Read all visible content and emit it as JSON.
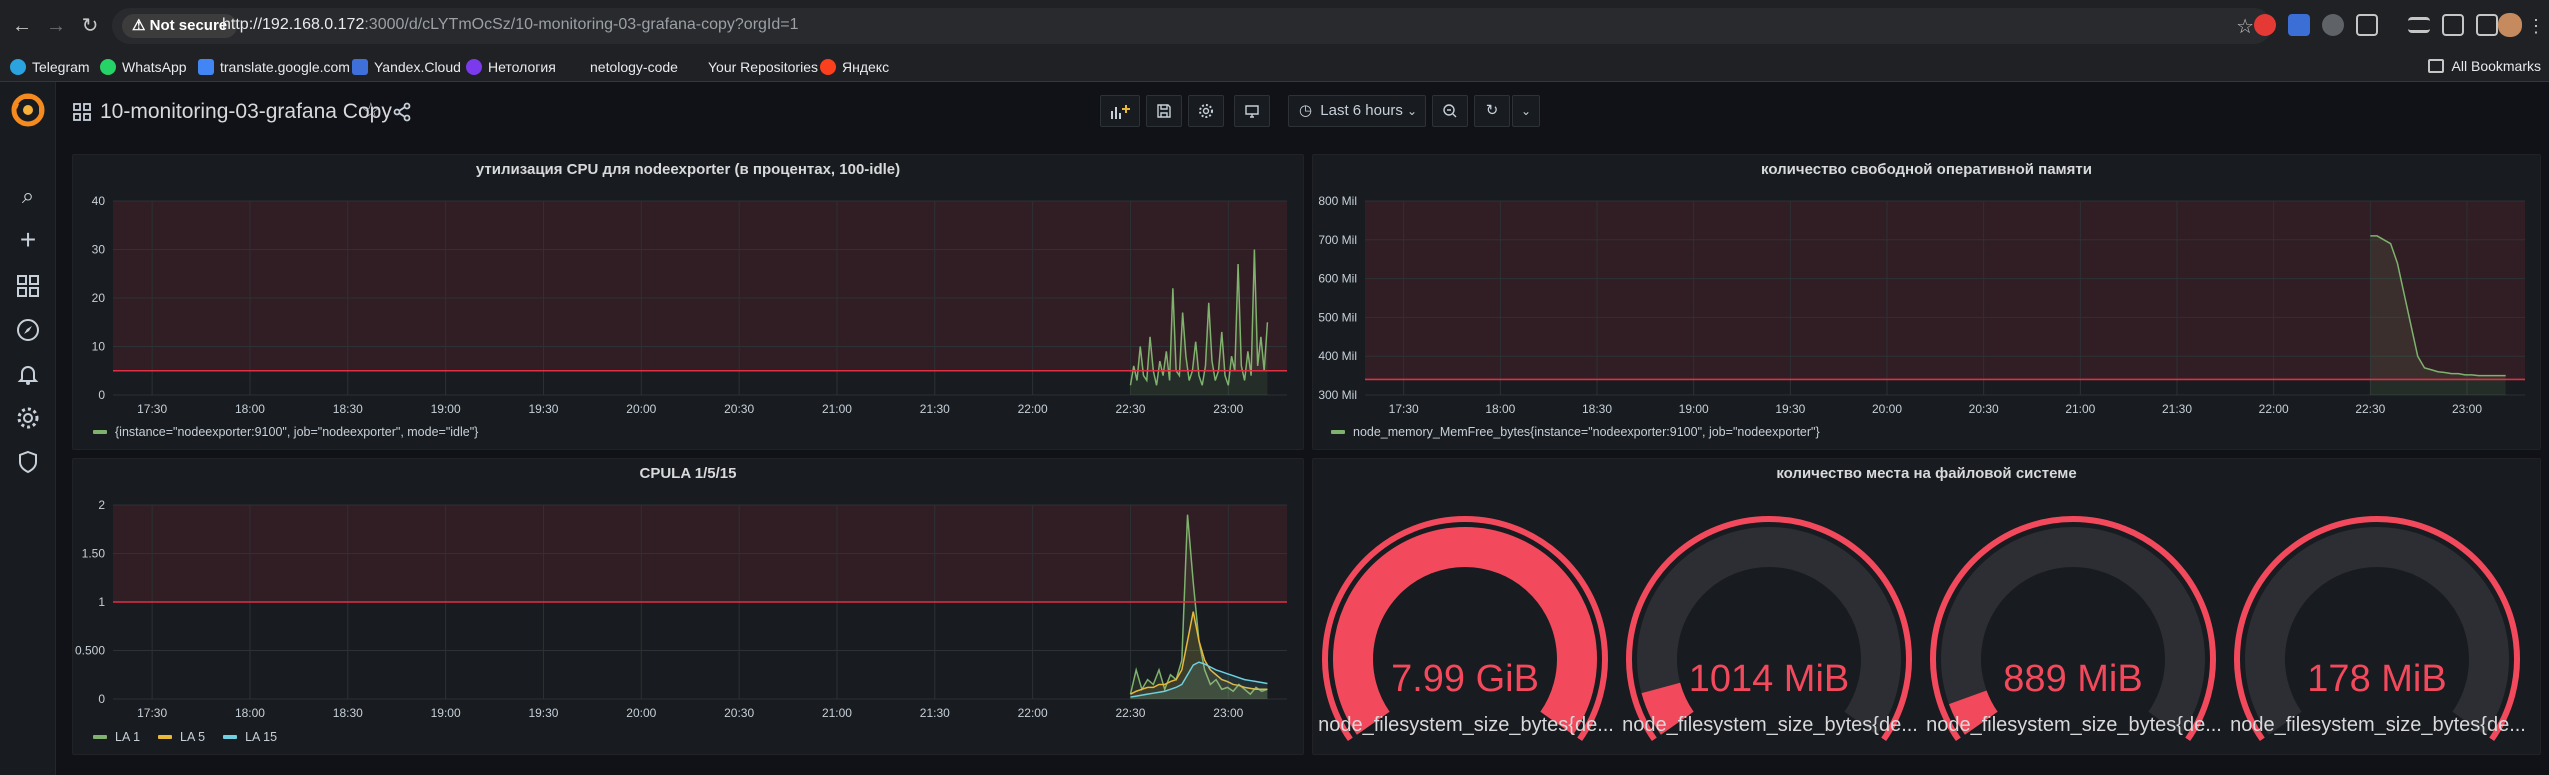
{
  "browser": {
    "security_label": "Not secure",
    "url_host": "http://192.168.0.172",
    "url_path": ":3000/d/cLYTmOcSz/10-monitoring-03-grafana-copy?orgId=1",
    "bookmarks": [
      {
        "label": "Telegram",
        "color": "#2aa3df"
      },
      {
        "label": "WhatsApp",
        "color": "#25d366"
      },
      {
        "label": "translate.google.com",
        "color": "#4285f4"
      },
      {
        "label": "Yandex.Cloud",
        "color": "#3f6fd8"
      },
      {
        "label": "Нетология",
        "color": "#7c3aed"
      },
      {
        "label": "netology-code",
        "color": "#202124"
      },
      {
        "label": "Your Repositories",
        "color": "#202124"
      },
      {
        "label": "Яндекс",
        "color": "#fc3f1d"
      }
    ],
    "all_bookmarks": "All Bookmarks"
  },
  "dashboard": {
    "title": "10-monitoring-03-grafana Copy",
    "time_range": "Last 6 hours"
  },
  "colors": {
    "series_green": "#7eb26d",
    "series_yellow": "#eab839",
    "series_cyan": "#6ed0e0",
    "threshold_red": "#e02f44",
    "gauge_red": "#f2495c",
    "gauge_track": "#2c2e33"
  },
  "panels": {
    "cpu": {
      "title": "утилизация CPU для nodeexporter (в процентах, 100-idle)",
      "legend": [
        "{instance=\"nodeexporter:9100\", job=\"nodeexporter\", mode=\"idle\"}"
      ]
    },
    "mem": {
      "title": "количество свободной оперативной памяти",
      "legend": [
        "node_memory_MemFree_bytes{instance=\"nodeexporter:9100\", job=\"nodeexporter\"}"
      ]
    },
    "la": {
      "title": "CPULA 1/5/15",
      "legend": [
        "LA 1",
        "LA 5",
        "LA 15"
      ]
    },
    "fs": {
      "title": "количество места на файловой системе",
      "gauges": [
        {
          "value": "7.99 GiB",
          "fill": 1.0,
          "label": "node_filesystem_size_bytes{de..."
        },
        {
          "value": "1014 MiB",
          "fill": 0.08,
          "label": "node_filesystem_size_bytes{de..."
        },
        {
          "value": "889 MiB",
          "fill": 0.06,
          "label": "node_filesystem_size_bytes{de..."
        },
        {
          "value": "178 MiB",
          "fill": 0.0,
          "label": "node_filesystem_size_bytes{de..."
        }
      ]
    }
  },
  "chart_data": [
    {
      "type": "line",
      "title": "утилизация CPU для nodeexporter (в процентах, 100-idle)",
      "x_ticks": [
        "17:30",
        "18:00",
        "18:30",
        "19:00",
        "19:30",
        "20:00",
        "20:30",
        "21:00",
        "21:30",
        "22:00",
        "22:30",
        "23:00"
      ],
      "y_ticks": [
        "0",
        "10",
        "20",
        "30",
        "40"
      ],
      "ylim": [
        0,
        40
      ],
      "threshold": 5,
      "series": [
        {
          "name": "{instance=\"nodeexporter:9100\", job=\"nodeexporter\", mode=\"idle\"}",
          "x_start": "22:30",
          "x_end": "23:12",
          "values": [
            2,
            6,
            3,
            10,
            4,
            3,
            12,
            5,
            2,
            7,
            4,
            9,
            3,
            22,
            5,
            4,
            17,
            8,
            3,
            5,
            11,
            4,
            2,
            6,
            19,
            7,
            3,
            5,
            13,
            4,
            2,
            8,
            5,
            27,
            6,
            3,
            9,
            4,
            30,
            6,
            12,
            5,
            15
          ]
        }
      ]
    },
    {
      "type": "line",
      "title": "количество свободной оперативной памяти",
      "x_ticks": [
        "17:30",
        "18:00",
        "18:30",
        "19:00",
        "19:30",
        "20:00",
        "20:30",
        "21:00",
        "21:30",
        "22:00",
        "22:30",
        "23:00"
      ],
      "y_ticks": [
        "300 Mil",
        "400 Mil",
        "500 Mil",
        "600 Mil",
        "700 Mil",
        "800 Mil"
      ],
      "ylim": [
        300,
        800
      ],
      "threshold": 340,
      "series": [
        {
          "name": "node_memory_MemFree_bytes{instance=\"nodeexporter:9100\", job=\"nodeexporter\"}",
          "x_start": "22:30",
          "x_end": "23:12",
          "values": [
            710,
            710,
            700,
            690,
            640,
            560,
            480,
            400,
            370,
            365,
            360,
            358,
            355,
            355,
            352,
            352,
            350,
            350,
            350,
            350,
            350
          ]
        }
      ]
    },
    {
      "type": "line",
      "title": "CPULA 1/5/15",
      "x_ticks": [
        "17:30",
        "18:00",
        "18:30",
        "19:00",
        "19:30",
        "20:00",
        "20:30",
        "21:00",
        "21:30",
        "22:00",
        "22:30",
        "23:00"
      ],
      "y_ticks": [
        "0",
        "0.500",
        "1",
        "1.50",
        "2"
      ],
      "ylim": [
        0,
        2
      ],
      "threshold": 1,
      "series": [
        {
          "name": "LA 1",
          "x_start": "22:30",
          "x_end": "23:12",
          "values": [
            0.05,
            0.3,
            0.1,
            0.2,
            0.15,
            0.3,
            0.1,
            0.25,
            0.2,
            0.4,
            1.9,
            1.2,
            0.6,
            0.3,
            0.15,
            0.2,
            0.1,
            0.12,
            0.08,
            0.15,
            0.1,
            0.05,
            0.12,
            0.08,
            0.1
          ]
        },
        {
          "name": "LA 5",
          "x_start": "22:30",
          "x_end": "23:12",
          "values": [
            0.05,
            0.08,
            0.1,
            0.12,
            0.12,
            0.15,
            0.15,
            0.18,
            0.2,
            0.3,
            0.6,
            0.9,
            0.6,
            0.4,
            0.3,
            0.25,
            0.2,
            0.18,
            0.15,
            0.14,
            0.12,
            0.11,
            0.1,
            0.1,
            0.1
          ]
        },
        {
          "name": "LA 15",
          "x_start": "22:30",
          "x_end": "23:12",
          "values": [
            0.02,
            0.03,
            0.04,
            0.05,
            0.06,
            0.07,
            0.08,
            0.1,
            0.12,
            0.15,
            0.25,
            0.35,
            0.38,
            0.36,
            0.33,
            0.3,
            0.28,
            0.26,
            0.24,
            0.22,
            0.2,
            0.19,
            0.18,
            0.17,
            0.16
          ]
        }
      ]
    }
  ]
}
